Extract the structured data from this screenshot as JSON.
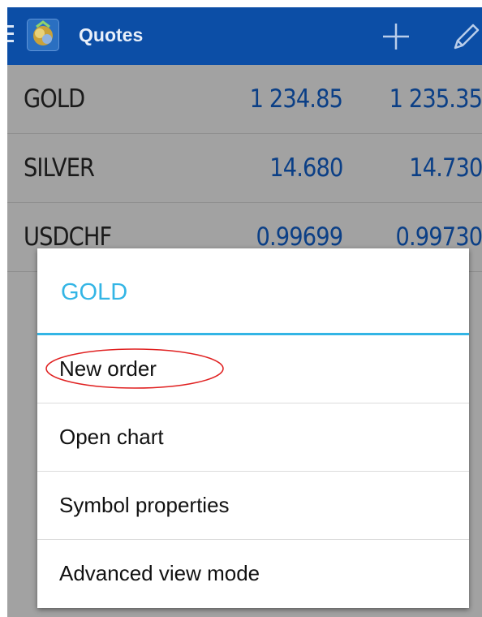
{
  "colors": {
    "action_bar": "#0c4ea6",
    "accent": "#33b5e5",
    "price": "#0b3f86",
    "highlight": "#e02020"
  },
  "header": {
    "title": "Quotes",
    "icons": [
      "menu-icon",
      "app-icon",
      "add-icon",
      "edit-icon"
    ]
  },
  "quotes": [
    {
      "symbol": "GOLD",
      "bid": "1 234.85",
      "ask": "1 235.35"
    },
    {
      "symbol": "SILVER",
      "bid": "14.680",
      "ask": "14.730"
    },
    {
      "symbol": "USDCHF",
      "bid": "0.99699",
      "ask": "0.99730"
    }
  ],
  "dialog": {
    "title": "GOLD",
    "items": [
      {
        "label": "New order",
        "highlighted": true
      },
      {
        "label": "Open chart"
      },
      {
        "label": "Symbol properties"
      },
      {
        "label": "Advanced view mode"
      }
    ]
  }
}
